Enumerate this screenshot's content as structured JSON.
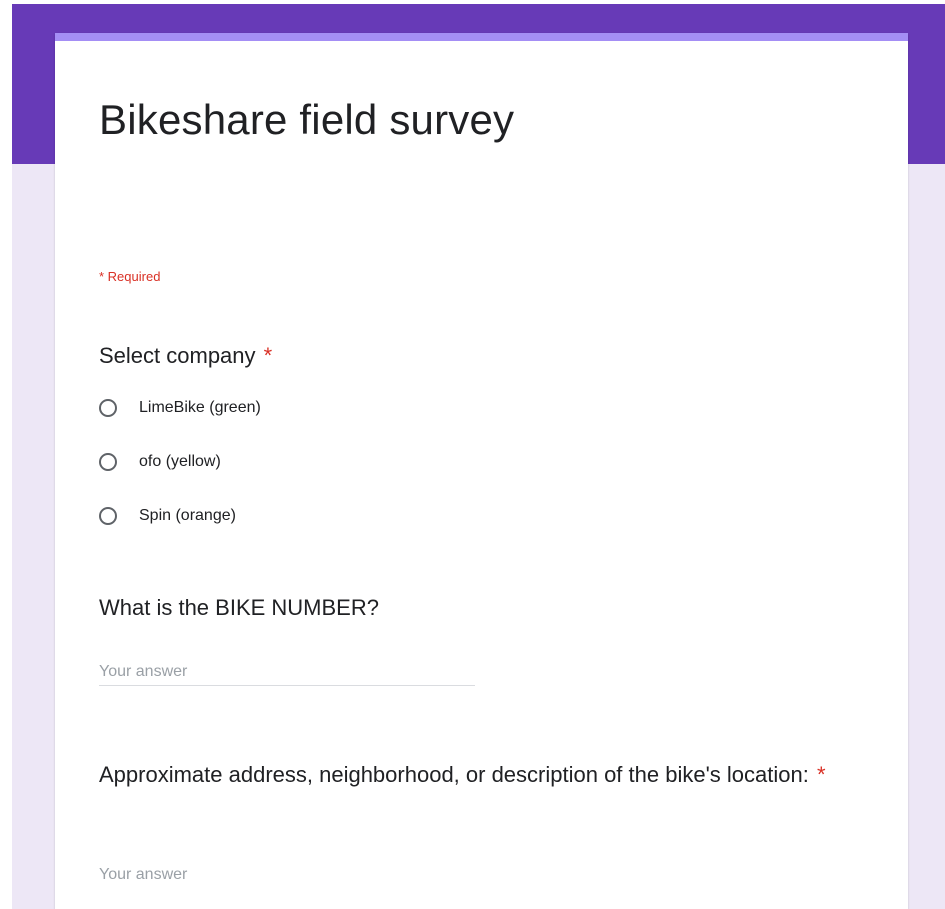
{
  "form": {
    "title": "Bikeshare field survey",
    "required_note": "* Required",
    "theme_color": "#673ab7",
    "background_color": "#ede7f6",
    "accent_color": "#a48ef5",
    "required_color": "#d93025"
  },
  "questions": {
    "company": {
      "title": "Select company",
      "required_marker": "*",
      "options": [
        "LimeBike (green)",
        "ofo (yellow)",
        "Spin (orange)"
      ]
    },
    "bike_number": {
      "title": "What is the BIKE NUMBER?",
      "placeholder": "Your answer"
    },
    "location": {
      "title": "Approximate address, neighborhood, or description of the bike's location:",
      "required_marker": "*",
      "placeholder": "Your answer"
    }
  }
}
